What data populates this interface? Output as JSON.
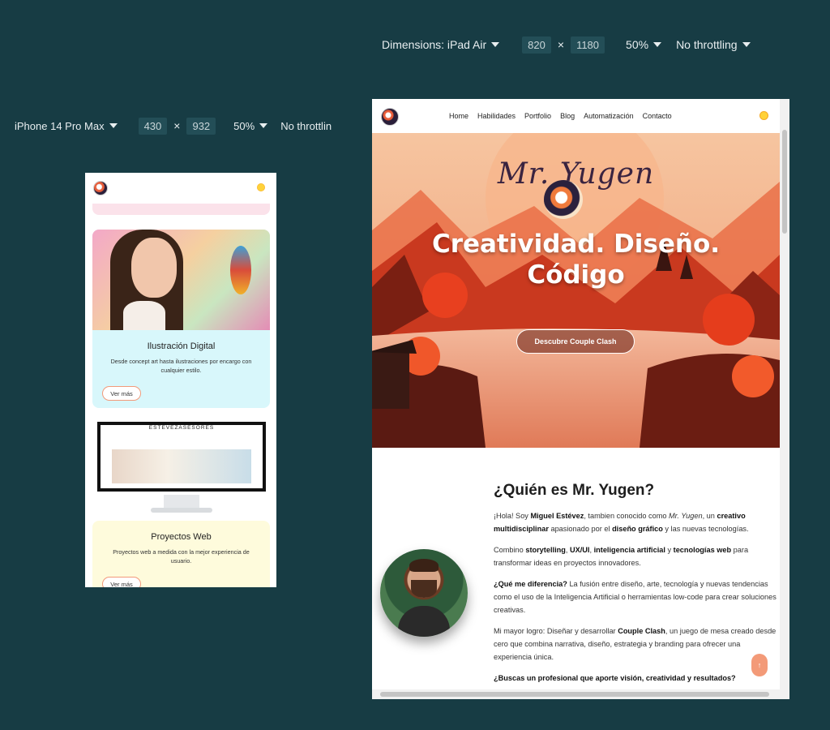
{
  "devtools_ipad": {
    "dimensions_label": "Dimensions: iPad Air",
    "width": "820",
    "height": "1180",
    "zoom": "50%",
    "throttling": "No throttling",
    "times": "×"
  },
  "devtools_phone": {
    "device": "iPhone 14 Pro Max",
    "width": "430",
    "height": "932",
    "zoom": "50%",
    "throttling": "No throttlin",
    "times": "×"
  },
  "site": {
    "nav": [
      "Home",
      "Habilidades",
      "Portfolio",
      "Blog",
      "Automatización",
      "Contacto"
    ],
    "hero": {
      "signature": "Mr. Yugen",
      "title_line1": "Creatividad. Diseño.",
      "title_line2": "Código",
      "cta": "Descubre Couple Clash"
    },
    "about": {
      "title": "¿Quién es Mr. Yugen?",
      "p1": [
        {
          "t": "¡Hola! Soy "
        },
        {
          "b": "Miguel Estévez"
        },
        {
          "t": ", tambien conocido como "
        },
        {
          "i": "Mr. Yugen"
        },
        {
          "t": ", un "
        },
        {
          "b": "creativo multidisciplinar"
        },
        {
          "t": " apasionado por el "
        },
        {
          "b": "diseño gráfico"
        },
        {
          "t": " y las nuevas tecnologías."
        }
      ],
      "p2": [
        {
          "t": "Combino "
        },
        {
          "b": "storytelling"
        },
        {
          "t": ", "
        },
        {
          "b": "UX/UI"
        },
        {
          "t": ", "
        },
        {
          "b": "inteligencia artificial"
        },
        {
          "t": " y "
        },
        {
          "b": "tecnologías web"
        },
        {
          "t": " para transformar ideas en proyectos innovadores."
        }
      ],
      "p3": [
        {
          "b": "¿Qué me diferencia?"
        },
        {
          "t": " La fusión entre diseño, arte, tecnología y nuevas tendencias como el uso de la Inteligencia Artificial o herramientas low-code para crear soluciones creativas."
        }
      ],
      "p4": [
        {
          "t": "Mi mayor logro: Diseñar y desarrollar "
        },
        {
          "b": "Couple Clash"
        },
        {
          "t": ", un juego de mesa creado desde cero que combina narrativa, diseño, estrategia y branding para ofrecer una experiencia única."
        }
      ],
      "p5": [
        {
          "b": "¿Buscas un profesional que aporte visión, creatividad y resultados?"
        }
      ]
    },
    "scroll_top_label": "↑"
  },
  "mobile": {
    "card1": {
      "title": "Ilustración Digital",
      "text": "Desde concept art hasta ilustraciones por encargo con cualquier estilo.",
      "button": "Ver más"
    },
    "monitor_brand": "ESTEVEZASESORES",
    "card2": {
      "title": "Proyectos Web",
      "text": "Proyectos web a medida con la mejor experiencia de usuario.",
      "button": "Ver más"
    }
  },
  "colors": {
    "background": "#173c44",
    "hero_sky": "#f3b08a",
    "hero_red": "#d9331b",
    "accent_orange": "#f39a78",
    "card_cyan": "#d8f7fb",
    "card_yellow": "#fefbdc"
  }
}
